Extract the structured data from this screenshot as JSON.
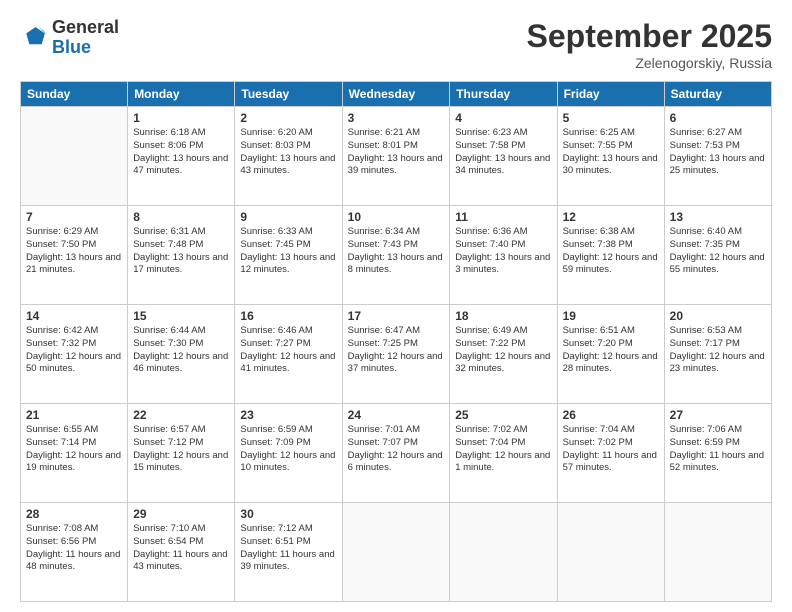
{
  "header": {
    "logo": {
      "general": "General",
      "blue": "Blue"
    },
    "title": "September 2025",
    "location": "Zelenogorskiy, Russia"
  },
  "days_of_week": [
    "Sunday",
    "Monday",
    "Tuesday",
    "Wednesday",
    "Thursday",
    "Friday",
    "Saturday"
  ],
  "weeks": [
    [
      null,
      {
        "date": 1,
        "sunrise": "6:18 AM",
        "sunset": "8:06 PM",
        "daylight": "13 hours and 47 minutes."
      },
      {
        "date": 2,
        "sunrise": "6:20 AM",
        "sunset": "8:03 PM",
        "daylight": "13 hours and 43 minutes."
      },
      {
        "date": 3,
        "sunrise": "6:21 AM",
        "sunset": "8:01 PM",
        "daylight": "13 hours and 39 minutes."
      },
      {
        "date": 4,
        "sunrise": "6:23 AM",
        "sunset": "7:58 PM",
        "daylight": "13 hours and 34 minutes."
      },
      {
        "date": 5,
        "sunrise": "6:25 AM",
        "sunset": "7:55 PM",
        "daylight": "13 hours and 30 minutes."
      },
      {
        "date": 6,
        "sunrise": "6:27 AM",
        "sunset": "7:53 PM",
        "daylight": "13 hours and 25 minutes."
      }
    ],
    [
      {
        "date": 7,
        "sunrise": "6:29 AM",
        "sunset": "7:50 PM",
        "daylight": "13 hours and 21 minutes."
      },
      {
        "date": 8,
        "sunrise": "6:31 AM",
        "sunset": "7:48 PM",
        "daylight": "13 hours and 17 minutes."
      },
      {
        "date": 9,
        "sunrise": "6:33 AM",
        "sunset": "7:45 PM",
        "daylight": "13 hours and 12 minutes."
      },
      {
        "date": 10,
        "sunrise": "6:34 AM",
        "sunset": "7:43 PM",
        "daylight": "13 hours and 8 minutes."
      },
      {
        "date": 11,
        "sunrise": "6:36 AM",
        "sunset": "7:40 PM",
        "daylight": "13 hours and 3 minutes."
      },
      {
        "date": 12,
        "sunrise": "6:38 AM",
        "sunset": "7:38 PM",
        "daylight": "12 hours and 59 minutes."
      },
      {
        "date": 13,
        "sunrise": "6:40 AM",
        "sunset": "7:35 PM",
        "daylight": "12 hours and 55 minutes."
      }
    ],
    [
      {
        "date": 14,
        "sunrise": "6:42 AM",
        "sunset": "7:32 PM",
        "daylight": "12 hours and 50 minutes."
      },
      {
        "date": 15,
        "sunrise": "6:44 AM",
        "sunset": "7:30 PM",
        "daylight": "12 hours and 46 minutes."
      },
      {
        "date": 16,
        "sunrise": "6:46 AM",
        "sunset": "7:27 PM",
        "daylight": "12 hours and 41 minutes."
      },
      {
        "date": 17,
        "sunrise": "6:47 AM",
        "sunset": "7:25 PM",
        "daylight": "12 hours and 37 minutes."
      },
      {
        "date": 18,
        "sunrise": "6:49 AM",
        "sunset": "7:22 PM",
        "daylight": "12 hours and 32 minutes."
      },
      {
        "date": 19,
        "sunrise": "6:51 AM",
        "sunset": "7:20 PM",
        "daylight": "12 hours and 28 minutes."
      },
      {
        "date": 20,
        "sunrise": "6:53 AM",
        "sunset": "7:17 PM",
        "daylight": "12 hours and 23 minutes."
      }
    ],
    [
      {
        "date": 21,
        "sunrise": "6:55 AM",
        "sunset": "7:14 PM",
        "daylight": "12 hours and 19 minutes."
      },
      {
        "date": 22,
        "sunrise": "6:57 AM",
        "sunset": "7:12 PM",
        "daylight": "12 hours and 15 minutes."
      },
      {
        "date": 23,
        "sunrise": "6:59 AM",
        "sunset": "7:09 PM",
        "daylight": "12 hours and 10 minutes."
      },
      {
        "date": 24,
        "sunrise": "7:01 AM",
        "sunset": "7:07 PM",
        "daylight": "12 hours and 6 minutes."
      },
      {
        "date": 25,
        "sunrise": "7:02 AM",
        "sunset": "7:04 PM",
        "daylight": "12 hours and 1 minute."
      },
      {
        "date": 26,
        "sunrise": "7:04 AM",
        "sunset": "7:02 PM",
        "daylight": "11 hours and 57 minutes."
      },
      {
        "date": 27,
        "sunrise": "7:06 AM",
        "sunset": "6:59 PM",
        "daylight": "11 hours and 52 minutes."
      }
    ],
    [
      {
        "date": 28,
        "sunrise": "7:08 AM",
        "sunset": "6:56 PM",
        "daylight": "11 hours and 48 minutes."
      },
      {
        "date": 29,
        "sunrise": "7:10 AM",
        "sunset": "6:54 PM",
        "daylight": "11 hours and 43 minutes."
      },
      {
        "date": 30,
        "sunrise": "7:12 AM",
        "sunset": "6:51 PM",
        "daylight": "11 hours and 39 minutes."
      },
      null,
      null,
      null,
      null
    ]
  ]
}
